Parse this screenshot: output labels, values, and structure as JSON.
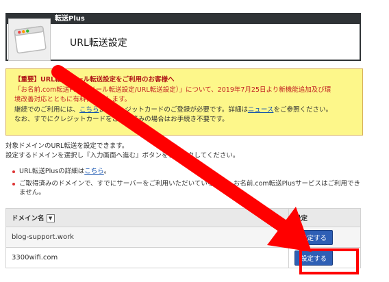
{
  "header": {
    "tag": "転送Plus",
    "title": "URL転送設定"
  },
  "notice": {
    "line1": "【重要】URL転送/メール転送設定をご利用のお客様へ",
    "line2a": "「お名前.com転送Plus（メール転送設定/URL転送設定）」について、2019年7月25日より新機能追加及び環",
    "line2b": "境改善対応とともに有料化いたします。",
    "line3_pre": "継続でのご利用には、",
    "line3_link1": "こちら",
    "line3_mid": "よりクレジットカードのご登録が必要です。詳細は",
    "line3_link2": "ニュース",
    "line3_post": "をご参照ください。",
    "line4": "なお、すでにクレジットカードをご登録済みの場合はお手続き不要です。"
  },
  "intro": {
    "line1": "対象ドメインのURL転送を設定できます。",
    "line2": "設定するドメインを選択し『入力画面へ進む』ボタンをクリックしてください。"
  },
  "bullets": {
    "b1_pre": "URL転送Plusの詳細は",
    "b1_link": "こちら",
    "b1_post": "。",
    "b2": "ご取得済みのドメインで、すでにサーバーをご利用いただいている場合、お名前.com転送Plusサービスはご利用できません。"
  },
  "table": {
    "col_domain": "ドメイン名",
    "col_setting": "設定",
    "rows": [
      {
        "domain": "blog-support.work",
        "button": "設定する"
      },
      {
        "domain": "3300wifi.com",
        "button": "設定する"
      }
    ]
  },
  "colors": {
    "notice_bg": "#fdf78a",
    "button": "#2e5fb5",
    "annotation": "#ff0000"
  },
  "icons": {
    "app": "browser-window-icon",
    "sort": "sort-down-icon"
  }
}
